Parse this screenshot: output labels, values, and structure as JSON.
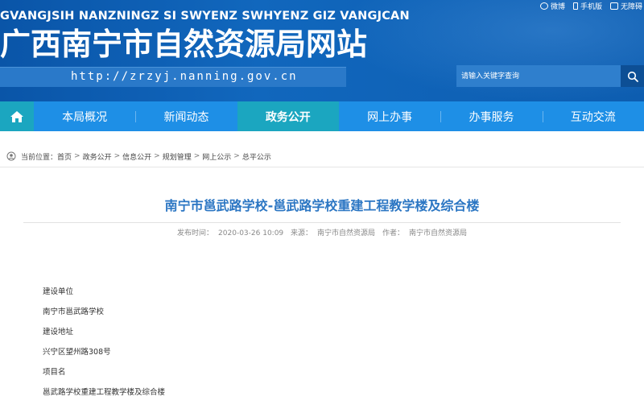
{
  "header": {
    "pinyin": "GVANGJSIH NANZNINGZ SI SWYENZ SWHYENZ GIZ VANGJCAN",
    "site_name": "广西南宁市自然资源局网站",
    "url": "http://zrzyj.nanning.gov.cn",
    "top_links": [
      {
        "icon": "weibo-icon",
        "label": "微博"
      },
      {
        "icon": "phone-icon",
        "label": "手机版"
      },
      {
        "icon": "accessibility-icon",
        "label": "无障碍"
      }
    ],
    "search_placeholder": "请输入关键字查询"
  },
  "nav": {
    "items": [
      {
        "label": "本局概况",
        "active": false
      },
      {
        "label": "新闻动态",
        "active": false
      },
      {
        "label": "政务公开",
        "active": true
      },
      {
        "label": "网上办事",
        "active": false
      },
      {
        "label": "办事服务",
        "active": false
      },
      {
        "label": "互动交流",
        "active": false
      }
    ]
  },
  "breadcrumb": {
    "prefix": "当前位置：",
    "items": [
      "首页",
      "政务公开",
      "信息公开",
      "规划管理",
      "网上公示",
      "总平公示"
    ],
    "separator": ">"
  },
  "article": {
    "title": "南宁市邕武路学校-邕武路学校重建工程教学楼及综合楼",
    "publish_label": "发布时间：",
    "publish_time": "2020-03-26 10:09",
    "source_label": "来源：",
    "source": "南宁市自然资源局",
    "author_label": "作者：",
    "author": "南宁市自然资源局",
    "content": [
      "建设单位",
      "南宁市邕武路学校",
      "建设地址",
      "兴宁区望州路308号",
      "项目名",
      "邕武路学校重建工程教学楼及综合楼"
    ]
  },
  "colors": {
    "header_blue": "#0d5fb3",
    "nav_blue": "#1e8fe6",
    "nav_active": "#1ba6c0",
    "title_blue": "#2b76c3"
  }
}
